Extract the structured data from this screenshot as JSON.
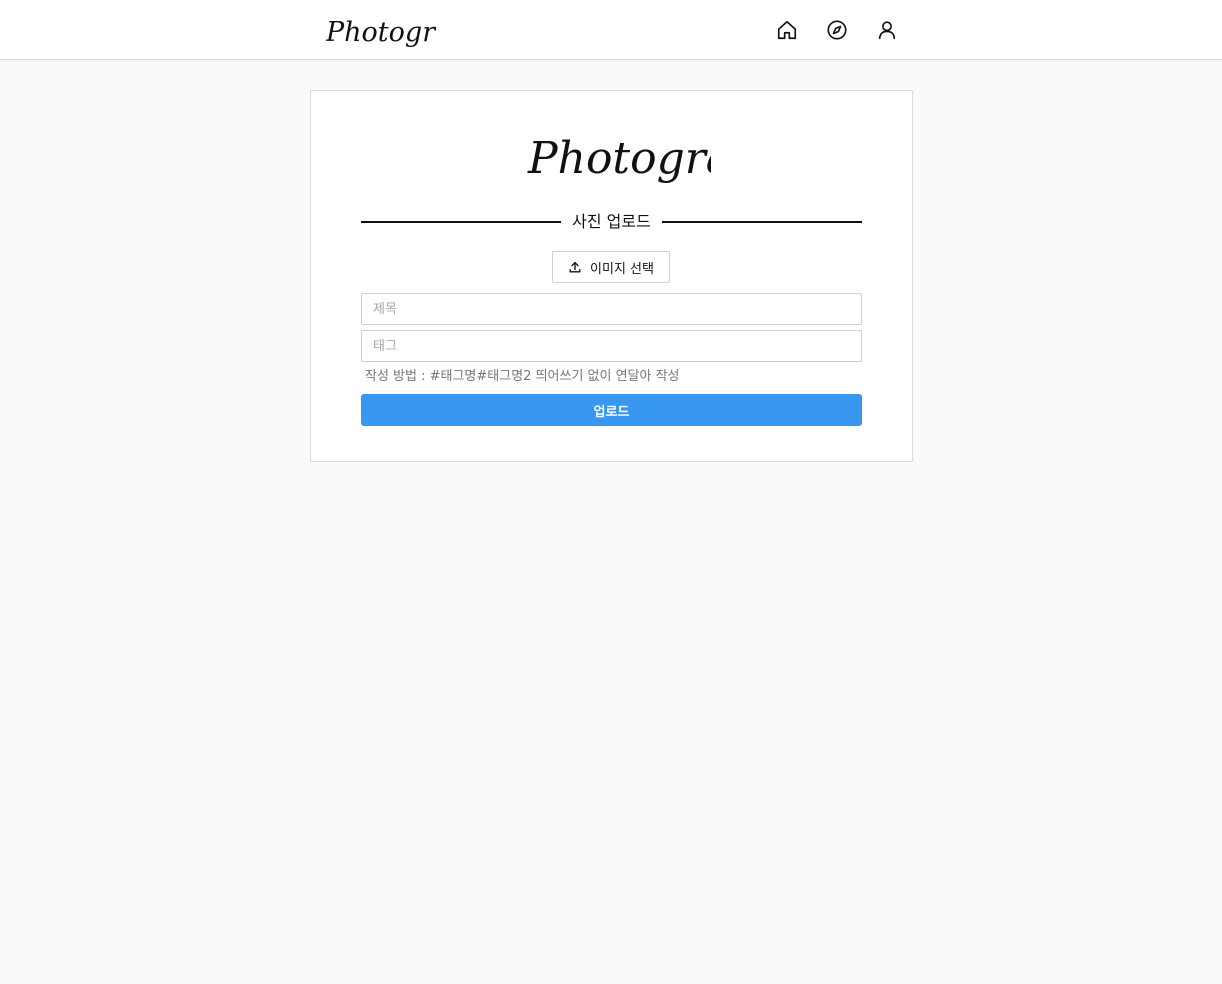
{
  "header": {
    "logo_text": "Photogram",
    "nav": {
      "home_icon": "home-icon",
      "explore_icon": "compass-icon",
      "profile_icon": "user-icon"
    }
  },
  "upload_card": {
    "logo_text": "Photogram",
    "section_title": "사진 업로드",
    "select_image_label": "이미지 선택",
    "title_placeholder": "제목",
    "tags_placeholder": "태그",
    "tags_hint": "작성 방법 : #태그명#태그명2 띄어쓰기 없이 연달아 작성",
    "upload_label": "업로드"
  },
  "colors": {
    "background": "#fafafa",
    "card": "#ffffff",
    "border": "#dbdbdb",
    "accent": "#3897f0",
    "text": "#111111",
    "hint_text": "#777777"
  }
}
